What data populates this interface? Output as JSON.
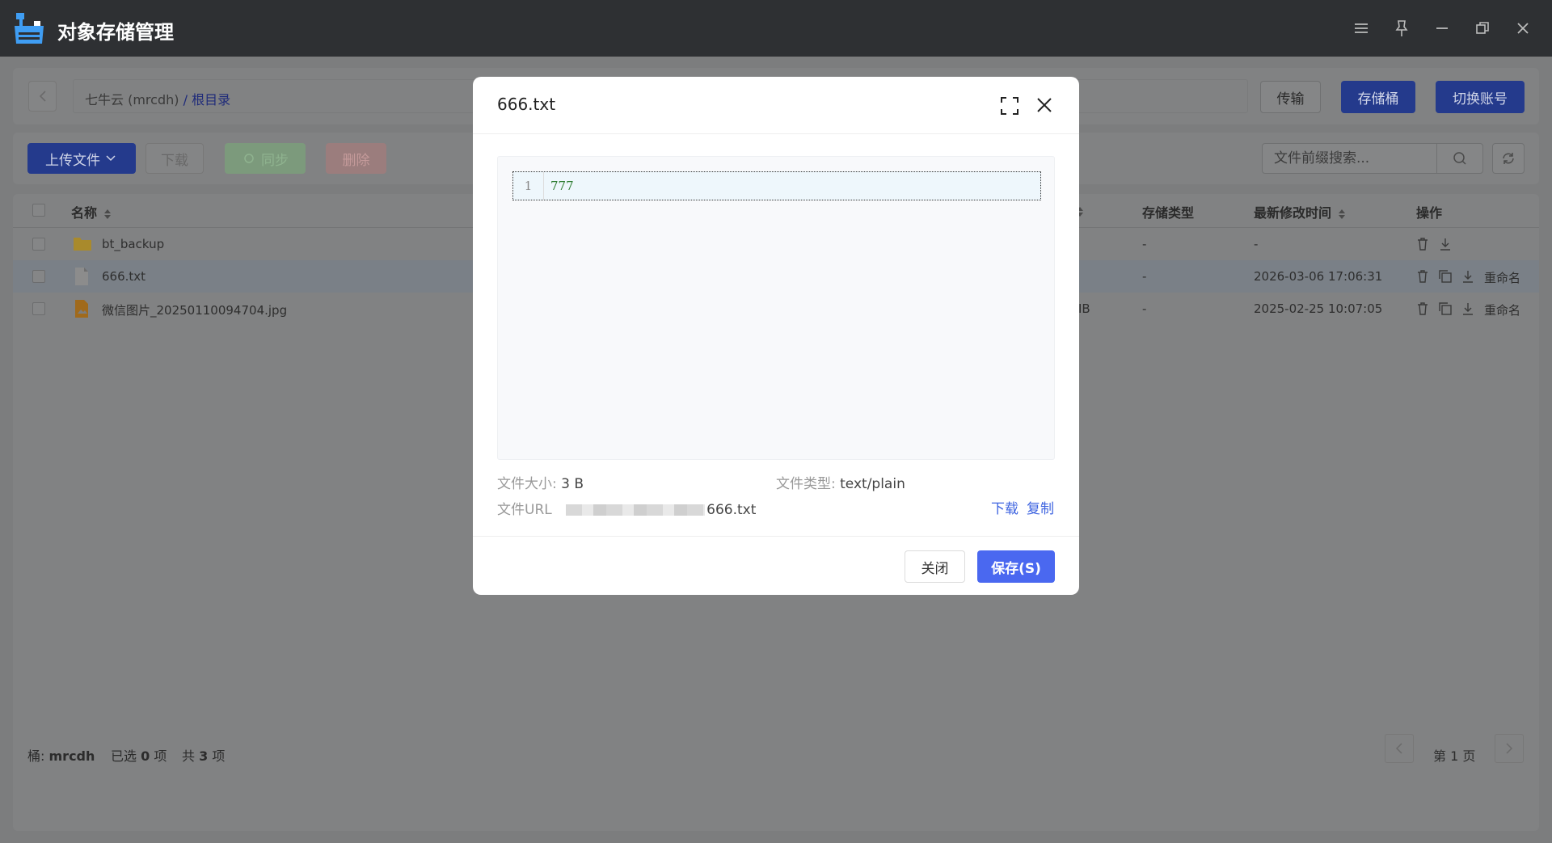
{
  "app": {
    "title": "对象存储管理"
  },
  "breadcrumb": {
    "provider": "七牛云 (mrcdh)",
    "sep": "/",
    "current": "根目录"
  },
  "top_buttons": {
    "transfer": "传输",
    "bucket": "存储桶",
    "switch_account": "切换账号"
  },
  "toolbar": {
    "upload": "上传文件",
    "download": "下载",
    "sync": "同步",
    "delete": "删除",
    "search_placeholder": "文件前缀搜索..."
  },
  "table": {
    "headers": {
      "name": "名称",
      "storage_type": "存储类型",
      "modified": "最新修改时间",
      "actions": "操作"
    },
    "rows": [
      {
        "name": "bt_backup",
        "size_partial": "",
        "storage_type": "-",
        "modified": "-",
        "icon": "folder-icon"
      },
      {
        "name": "666.txt",
        "size_partial": "",
        "storage_type": "-",
        "modified": "2026-03-06 17:06:31",
        "icon": "text-file-icon",
        "rename": "重命名"
      },
      {
        "name": "微信图片_20250110094704.jpg",
        "size_partial": "IB",
        "storage_type": "-",
        "modified": "2025-02-25 10:07:05",
        "icon": "image-file-icon",
        "rename": "重命名"
      }
    ]
  },
  "footer": {
    "bucket_label": "桶:",
    "bucket": "mrcdh",
    "selected_pre": "已选",
    "selected_count": "0",
    "selected_post": "项",
    "total_pre": "共",
    "total_count": "3",
    "total_post": "项",
    "page": "第 1 页"
  },
  "dialog": {
    "title": "666.txt",
    "line_number": "1",
    "content": "777",
    "size_label": "文件大小:",
    "size_value": "3 B",
    "type_label": "文件类型:",
    "type_value": "text/plain",
    "url_label": "文件URL",
    "url_suffix": "666.txt",
    "download_link": "下载",
    "copy_link": "复制",
    "close_button": "关闭",
    "save_button": "保存(S)"
  },
  "colors": {
    "primary": "#4a68f0",
    "titlebar": "#2e3033",
    "overlay_bg": "#7c7d7e"
  }
}
